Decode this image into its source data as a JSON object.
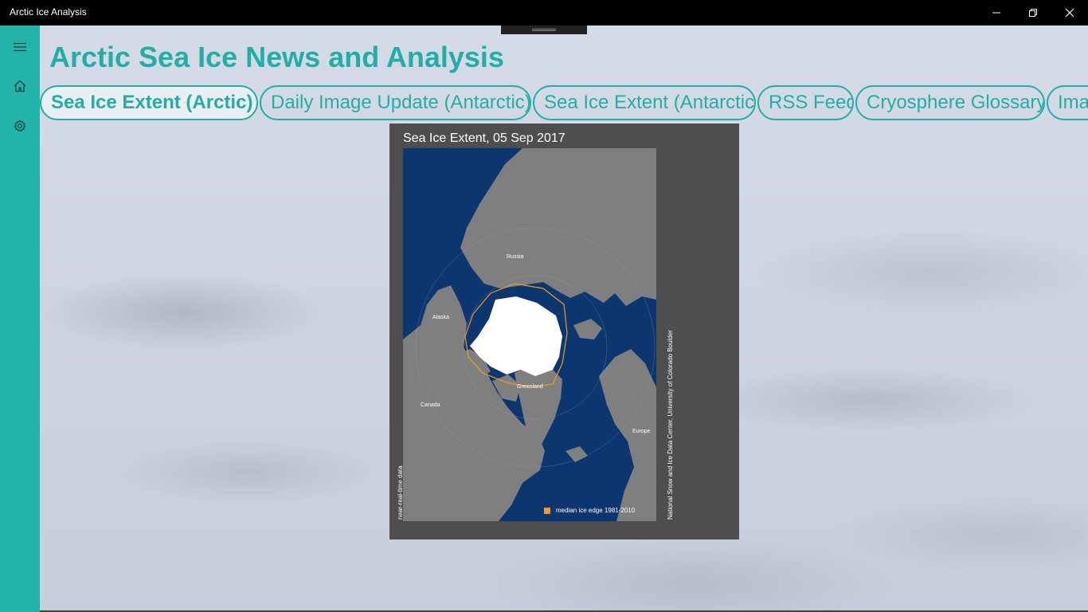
{
  "window": {
    "title": "Arctic Ice Analysis"
  },
  "header": {
    "title": "Arctic Sea Ice News and Analysis"
  },
  "tabs": [
    {
      "label": "Sea Ice Extent (Arctic)",
      "active": true
    },
    {
      "label": "Daily Image Update (Antarctic)",
      "active": false
    },
    {
      "label": "Sea Ice Extent (Antarctic)",
      "active": false
    },
    {
      "label": "RSS Feed",
      "active": false
    },
    {
      "label": "Cryosphere Glossary",
      "active": false
    },
    {
      "label": "Ima",
      "active": false
    }
  ],
  "sidebar": {
    "items": [
      {
        "icon": "hamburger-menu-icon"
      },
      {
        "icon": "home-icon"
      },
      {
        "icon": "gear-icon"
      }
    ]
  },
  "figure": {
    "title": "Sea Ice Extent, 05 Sep 2017",
    "side_left": "near-real-time data",
    "side_right": "National Snow and Ice Data Center, University of Colorado Boulder",
    "labels": {
      "russia": "Russia",
      "alaska": "Alaska",
      "greenland": "Greenland",
      "canada": "Canada",
      "europe": "Europe"
    },
    "legend": "median ice edge 1981-2010"
  },
  "colors": {
    "accent": "#23aea5",
    "sidebar": "#22b3a9",
    "ocean": "#0c3670",
    "land": "#7f7f7f",
    "ice": "#ffffff",
    "median_edge": "#f29a1e"
  }
}
